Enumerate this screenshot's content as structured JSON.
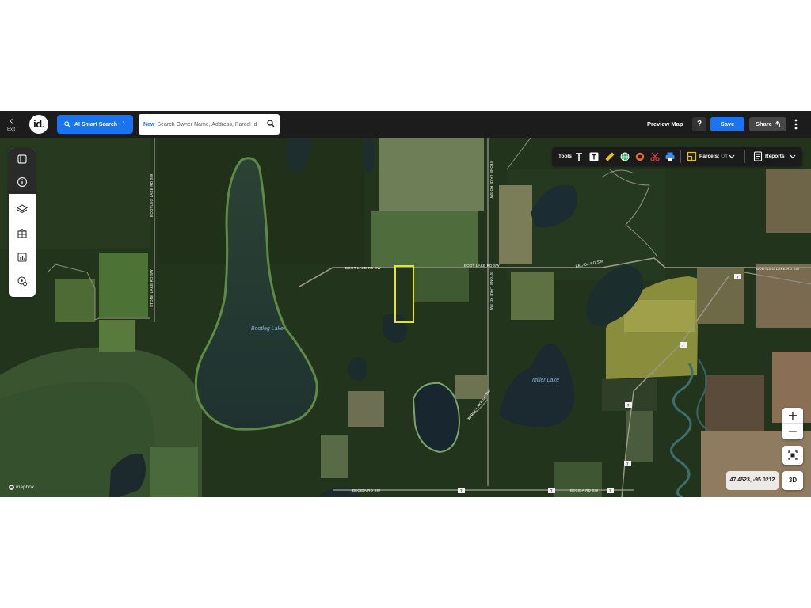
{
  "topbar": {
    "exit_label": "Exit",
    "logo_text": "id",
    "logo_dot": ".",
    "ai_search_label": "AI Smart Search",
    "search_new_badge": "New",
    "search_placeholder": "Search Owner Name, Address, Parcel Id",
    "preview_map_label": "Preview Map",
    "help_label": "?",
    "save_label": "Save",
    "share_label": "Share"
  },
  "left_panel": {
    "icons": [
      "panel-toggle-icon",
      "info-icon",
      "layers-icon",
      "buildings-icon",
      "report-chart-icon",
      "location-settings-icon"
    ]
  },
  "toolsbar": {
    "tools_label": "Tools",
    "parcels_label": "Parcels:",
    "parcels_state": "Off",
    "reports_label": "Reports",
    "tool_icons": [
      "text-icon",
      "text-box-icon",
      "ruler-icon",
      "globe-pin-icon",
      "radius-icon",
      "scissors-icon",
      "print-icon"
    ]
  },
  "map": {
    "lakes": [
      "Bootleg Lake",
      "Miller Lake"
    ],
    "roads": [
      "BOOT LAKE RD SW",
      "BOOT LAKE RD SW",
      "BECIDA RD SW",
      "BOOTLEG LAKE RD SW",
      "BOOTLEG LAKE RD SW",
      "STONE LAKE RD SW",
      "STONE LAKE RD SW",
      "STONE LAKE RD SW",
      "APPLE LAKE LN SW",
      "BECIDA RD SW"
    ],
    "shields": [
      "7",
      "7",
      "7",
      "7",
      "7",
      "7",
      "7"
    ],
    "attribution": "mapbox",
    "colors": {
      "water": "#22342f",
      "forest": "#22331d",
      "field": "#4a6a3a",
      "parcel_outline": "#e8e22a"
    }
  },
  "controls": {
    "zoom_in": "+",
    "zoom_out": "−",
    "coordinates": "47.4523, -95.0212",
    "three_d_label": "3D"
  }
}
